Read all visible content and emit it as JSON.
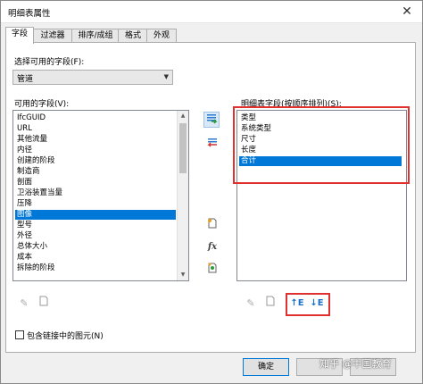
{
  "window": {
    "title": "明细表属性",
    "close_glyph": "✕"
  },
  "tabs": [
    {
      "label": "字段",
      "active": true
    },
    {
      "label": "过滤器"
    },
    {
      "label": "排序/成组"
    },
    {
      "label": "格式"
    },
    {
      "label": "外观"
    }
  ],
  "select_from": {
    "label": "选择可用的字段(F):",
    "value": "管道"
  },
  "available": {
    "label": "可用的字段(V):",
    "items": [
      "IfcGUID",
      "URL",
      "其他流量",
      "内径",
      "创建的阶段",
      "制造商",
      "剖面",
      "卫浴装置当量",
      "压降",
      "图像",
      "型号",
      "外径",
      "总体大小",
      "成本",
      "拆除的阶段"
    ],
    "selected_index": 9
  },
  "scheduled": {
    "label": "明细表字段(按顺序排列)(S):",
    "items": [
      "类型",
      "系统类型",
      "尺寸",
      "长度",
      "合计"
    ],
    "selected_index": 4
  },
  "icons": {
    "add": "add-field-icon",
    "remove": "remove-field-icon",
    "new_param": "new-parameter-icon",
    "formula": "fx",
    "combine": "combine-parameters-icon",
    "edit": "edit-pencil-icon",
    "delete": "delete-icon",
    "move_up": "↑E",
    "move_down": "↓E"
  },
  "checkbox": {
    "label": "包含链接中的图元(N)",
    "checked": false
  },
  "buttons": {
    "ok": "确定"
  },
  "watermark": "知乎 @中国教育",
  "colors": {
    "accent": "#0078d7",
    "highlight": "#e03030"
  }
}
